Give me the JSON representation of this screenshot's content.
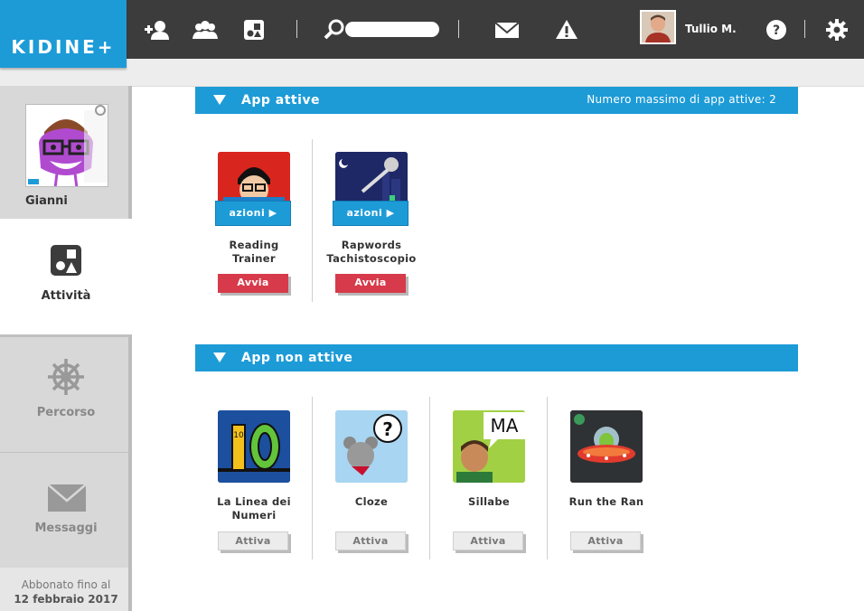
{
  "brand": {
    "logo_text": "KIDINE+",
    "accent": "#1d9bd7",
    "topbar_bg": "#3d3c3c"
  },
  "topbar": {
    "icons": [
      "add-student-icon",
      "group-icon",
      "activities-icon",
      "search-icon",
      "mail-icon",
      "warning-icon",
      "help-icon",
      "gear-icon"
    ],
    "search": {
      "value": "",
      "placeholder": ""
    },
    "user_name": "Tullio M."
  },
  "sidebar": {
    "student_name": "Gianni",
    "items": [
      {
        "label": "Attività",
        "icon": "activities-icon",
        "active": true
      },
      {
        "label": "Percorso",
        "icon": "ship-wheel-icon",
        "active": false
      },
      {
        "label": "Messaggi",
        "icon": "envelope-icon",
        "active": false
      }
    ],
    "subscription_line1": "Abbonato fino al",
    "subscription_line2": "12 febbraio 2017"
  },
  "active_section": {
    "title": "App attive",
    "note": "Numero massimo di app attive: 2",
    "apps": [
      {
        "name_line1": "Reading",
        "name_line2": "Trainer",
        "overlay": "azioni",
        "button": "Avvia"
      },
      {
        "name_line1": "Rapwords",
        "name_line2": "Tachistoscopio",
        "overlay": "azioni",
        "button": "Avvia"
      }
    ]
  },
  "inactive_section": {
    "title": "App non attive",
    "apps": [
      {
        "name_line1": "La Linea dei",
        "name_line2": "Numeri",
        "button": "Attiva",
        "thumb_text": "10"
      },
      {
        "name_line1": "Cloze",
        "name_line2": "",
        "button": "Attiva",
        "thumb_text": "?"
      },
      {
        "name_line1": "Sillabe",
        "name_line2": "",
        "button": "Attiva",
        "thumb_text": "MA"
      },
      {
        "name_line1": "Run the Ran",
        "name_line2": "",
        "button": "Attiva",
        "thumb_text": ""
      }
    ]
  }
}
